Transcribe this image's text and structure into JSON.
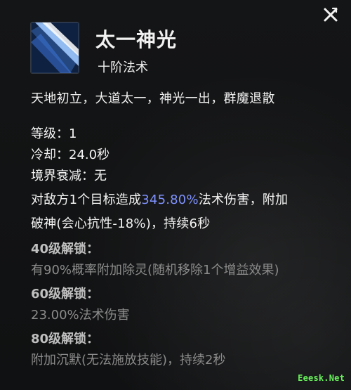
{
  "skill": {
    "title": "太一神光",
    "subtitle": "十阶法术",
    "description": "天地初立，大道太一，神光一出，群魔退散"
  },
  "stats": {
    "level": {
      "label": "等级：",
      "value": "1"
    },
    "cooldown": {
      "label": "冷却：",
      "value": "24.0秒"
    },
    "realm": {
      "label": "境界衰减：",
      "value": "无"
    }
  },
  "effect": {
    "prefix": "对敌方1个目标造成",
    "highlight": "345.80%",
    "suffix": "法术伤害，附加",
    "line2": "破神(会心抗性-18%)，持续6秒"
  },
  "unlocks": [
    {
      "title": "40级解锁：",
      "text": "有90%概率附加除灵(随机移除1个增益效果)"
    },
    {
      "title": "60级解锁：",
      "text": "23.00%法术伤害"
    },
    {
      "title": "80级解锁：",
      "text": "附加沉默(无法施放技能)，持续2秒"
    }
  ],
  "watermark": "Eeesk.Net",
  "colors": {
    "highlight": "#7f92ff",
    "watermark": "#68f25b"
  },
  "icons": {
    "close": "close-icon",
    "skill": "skill-icon"
  }
}
